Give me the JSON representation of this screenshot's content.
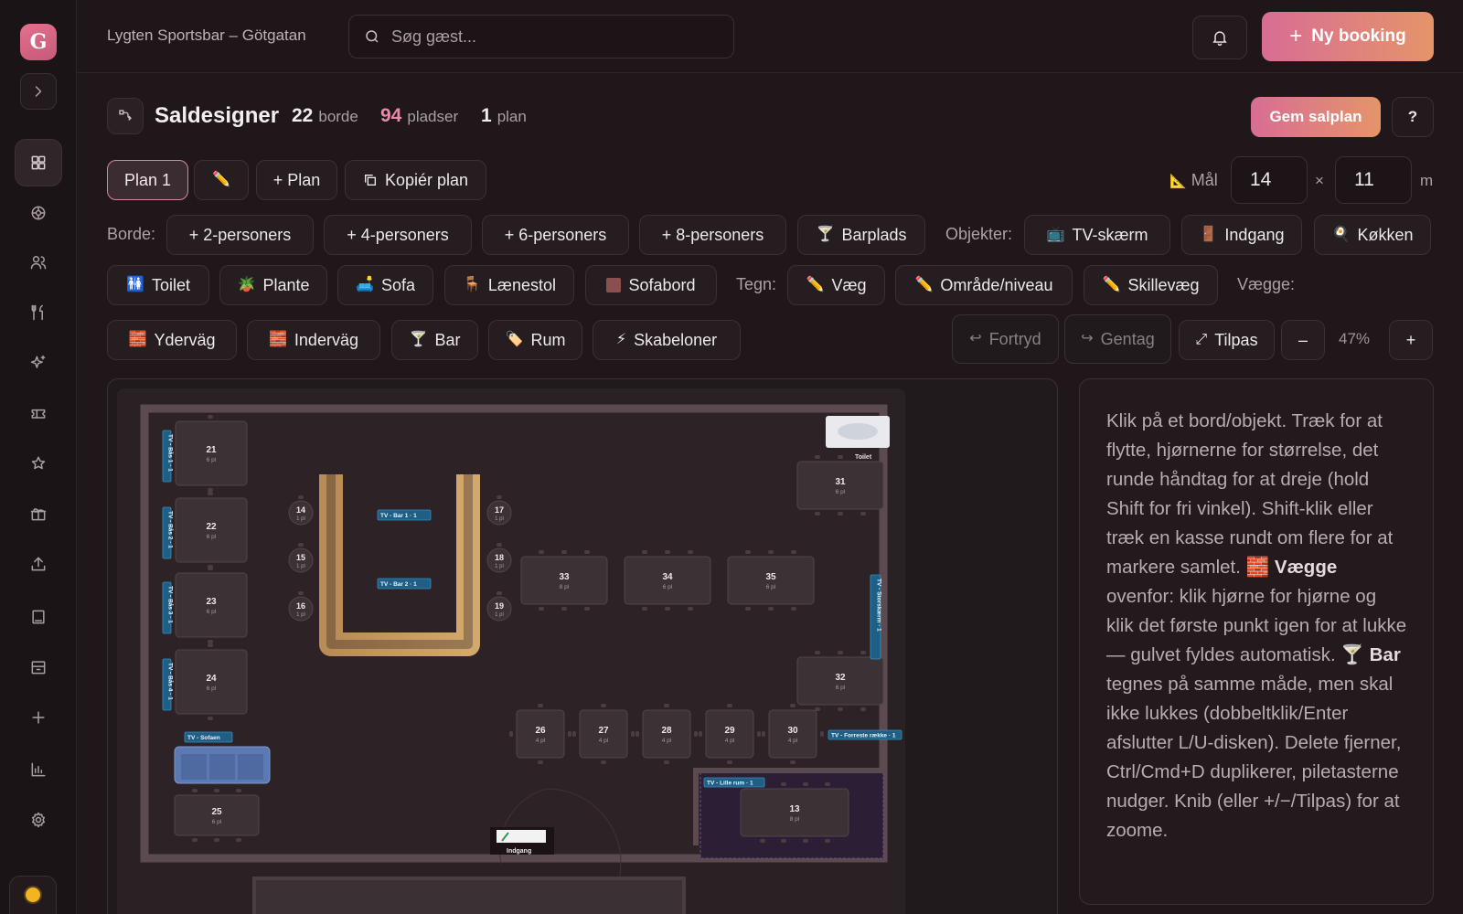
{
  "sidebar": {
    "logo_letter": "G",
    "items": [
      {
        "icon": "grid-icon"
      },
      {
        "icon": "dashboard-icon"
      },
      {
        "icon": "users-icon"
      },
      {
        "icon": "utensils-icon"
      },
      {
        "icon": "sparkles-icon"
      },
      {
        "icon": "ticket-icon"
      },
      {
        "icon": "star-icon"
      },
      {
        "icon": "gift-icon"
      },
      {
        "icon": "upload-icon"
      },
      {
        "icon": "book-icon"
      },
      {
        "icon": "archive-icon"
      },
      {
        "icon": "plus-icon"
      },
      {
        "icon": "bar-chart-icon"
      },
      {
        "icon": "settings-icon"
      }
    ]
  },
  "topbar": {
    "venue": "Lygten Sportsbar – Götgatan",
    "search_placeholder": "Søg gæst...",
    "new_booking_label": "Ny booking"
  },
  "header": {
    "title": "Saldesigner",
    "tables_count": "22",
    "tables_label": "borde",
    "seats_count": "94",
    "seats_label": "pladser",
    "plans_count": "1",
    "plans_label": "plan",
    "save_label": "Gem salplan",
    "help_label": "?"
  },
  "plan_row": {
    "plan1": "Plan 1",
    "add_plan": "+ Plan",
    "copy_plan": "Kopiér plan",
    "measure_label": "Mål",
    "width": "14",
    "times": "×",
    "height": "11",
    "unit": "m"
  },
  "tables_row": {
    "label": "Borde:",
    "two": "+ 2-personers",
    "four": "+ 4-personers",
    "six": "+ 6-personers",
    "eight": "+ 8-personers",
    "barseat": "Barplads",
    "objects_label": "Objekter:",
    "tv": "TV-skærm",
    "entrance": "Indgang",
    "kitchen": "Køkken"
  },
  "objects_row": {
    "toilet": "Toilet",
    "plant": "Plante",
    "sofa": "Sofa",
    "armchair": "Lænestol",
    "coffee_table": "Sofabord",
    "draw_label": "Tegn:",
    "wall": "Væg",
    "area": "Område/niveau",
    "divider": "Skillevæg",
    "walls_label": "Vægge:"
  },
  "walls_row": {
    "outer": "Yderväg",
    "inner": "Inderväg",
    "bar": "Bar",
    "room": "Rum",
    "templates": "Skabeloner",
    "undo": "Fortryd",
    "redo": "Gentag",
    "fit": "Tilpas",
    "zoom_out": "–",
    "zoom": "47%",
    "zoom_in": "+"
  },
  "floor": {
    "seat_unit": "pl",
    "tables": [
      {
        "id": "21",
        "seats": "6 pl"
      },
      {
        "id": "22",
        "seats": "6 pl"
      },
      {
        "id": "23",
        "seats": "6 pl"
      },
      {
        "id": "24",
        "seats": "6 pl"
      },
      {
        "id": "25",
        "seats": "6 pl"
      },
      {
        "id": "14",
        "seats": "1 pl"
      },
      {
        "id": "15",
        "seats": "1 pl"
      },
      {
        "id": "16",
        "seats": "1 pl"
      },
      {
        "id": "17",
        "seats": "1 pl"
      },
      {
        "id": "18",
        "seats": "1 pl"
      },
      {
        "id": "19",
        "seats": "1 pl"
      },
      {
        "id": "33",
        "seats": "8 pl"
      },
      {
        "id": "34",
        "seats": "6 pl"
      },
      {
        "id": "35",
        "seats": "6 pl"
      },
      {
        "id": "31",
        "seats": "6 pl"
      },
      {
        "id": "32",
        "seats": "6 pl"
      },
      {
        "id": "26",
        "seats": "4 pl"
      },
      {
        "id": "27",
        "seats": "4 pl"
      },
      {
        "id": "28",
        "seats": "4 pl"
      },
      {
        "id": "29",
        "seats": "4 pl"
      },
      {
        "id": "30",
        "seats": "4 pl"
      },
      {
        "id": "13",
        "seats": "8 pl"
      }
    ],
    "tv_labels": {
      "bar1": "TV - Bar 1 · 1",
      "bar2": "TV - Bar 2 · 1",
      "baas1": "TV - Bås 1 · 1",
      "baas2": "TV - Bås 2 · 1",
      "baas3": "TV - Bås 3 · 1",
      "baas4": "TV - Bås 4 · 1",
      "sofa": "TV - Sofaen",
      "big": "TV - Storskærm · 1",
      "front": "TV - Forreste række · 1",
      "small_room": "TV - Lille rum · 1"
    },
    "toilet_label": "Toilet",
    "entrance_label": "Indgang"
  },
  "help": {
    "part1": "Klik på et bord/objekt. Træk for at flytte, hjørnerne for størrelse, det runde håndtag for at dreje (hold Shift for fri vinkel). Shift-klik eller træk en kasse rundt om flere for at markere samlet. ",
    "walls_bold": "Vægge",
    "part2": " ovenfor: klik hjørne for hjørne og klik det første punkt igen for at lukke — gulvet fyldes automatisk. ",
    "bar_bold": "Bar",
    "part3": " tegnes på samme måde, men skal ikke lukkes (dobbeltklik/Enter afslutter L/U-disken). Delete fjerner, Ctrl/Cmd+D duplikerer, piletasterne nudger. Knib (eller +/−/Tilpas) for at zoome."
  },
  "colors": {
    "accent_start": "#d86d94",
    "accent_end": "#e5946a",
    "background": "#1f1719",
    "bar_counter": "#c49a60",
    "tv": "#1f5f86",
    "sofa": "#5878b0"
  }
}
